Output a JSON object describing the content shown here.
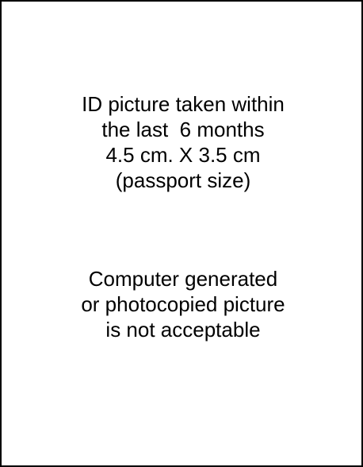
{
  "instructions": {
    "block_1": [
      "ID picture taken within",
      "the last  6 months",
      "4.5 cm. X 3.5 cm",
      "(passport size)"
    ],
    "block_2": [
      "Computer generated",
      "or photocopied picture",
      "is not acceptable"
    ]
  }
}
